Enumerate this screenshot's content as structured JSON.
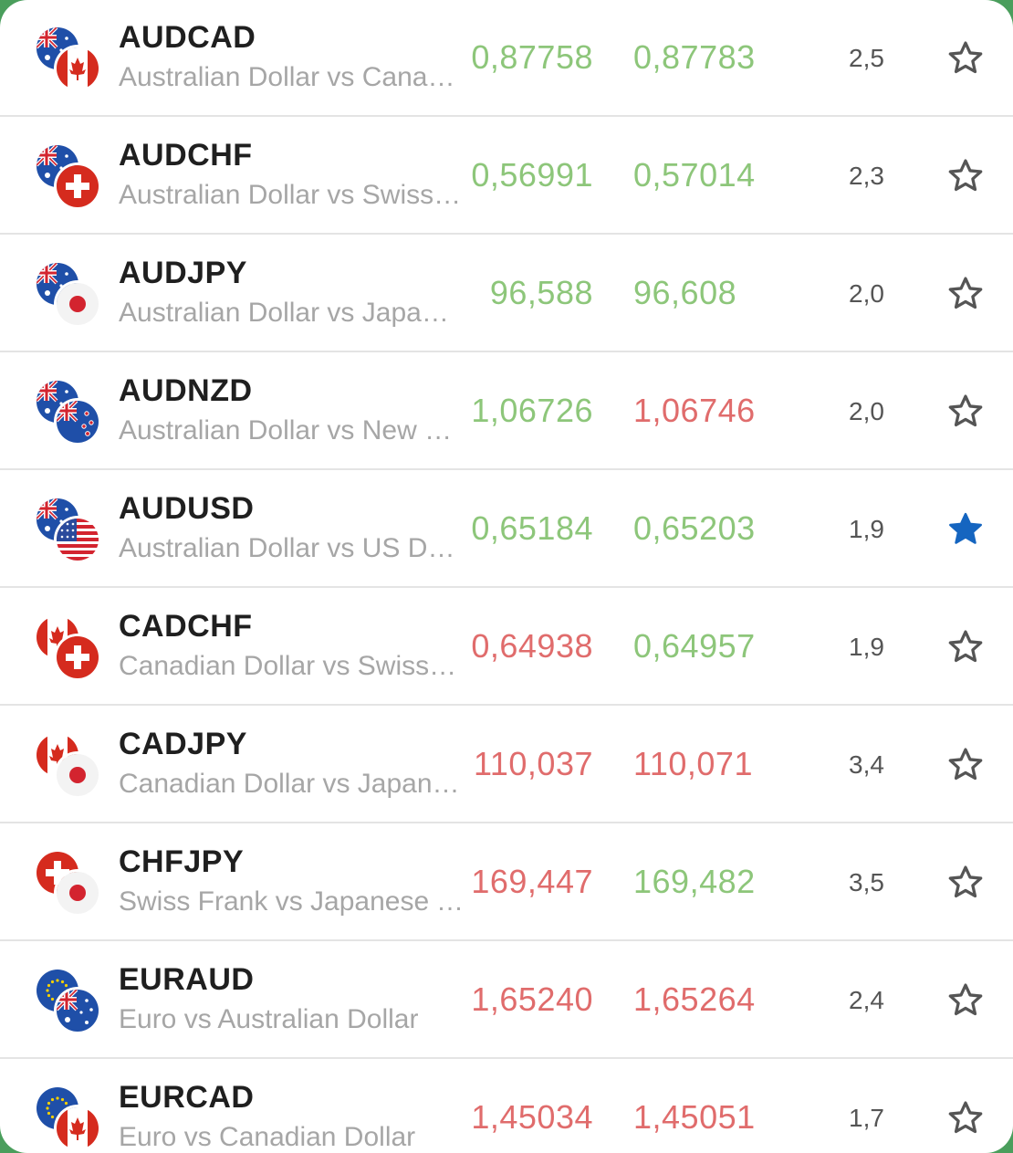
{
  "colors": {
    "up": "#8dc67a",
    "down": "#e06c6c",
    "star_active": "#1565c0",
    "star_inactive": "#555555"
  },
  "instruments": [
    {
      "symbol": "AUDCAD",
      "description": "Australian Dollar vs Canadian Dollar",
      "bid": "0,87758",
      "bid_dir": "up",
      "ask": "0,87783",
      "ask_dir": "up",
      "spread": "2,5",
      "favorite": false,
      "base_flag": "australia-flag-icon",
      "quote_flag": "canada-flag-icon"
    },
    {
      "symbol": "AUDCHF",
      "description": "Australian Dollar vs Swiss Frank",
      "bid": "0,56991",
      "bid_dir": "up",
      "ask": "0,57014",
      "ask_dir": "up",
      "spread": "2,3",
      "favorite": false,
      "base_flag": "australia-flag-icon",
      "quote_flag": "switzerland-flag-icon"
    },
    {
      "symbol": "AUDJPY",
      "description": "Australian Dollar vs Japanese Yen",
      "bid": "96,588",
      "bid_dir": "up",
      "ask": "96,608",
      "ask_dir": "up",
      "spread": "2,0",
      "favorite": false,
      "base_flag": "australia-flag-icon",
      "quote_flag": "japan-flag-icon"
    },
    {
      "symbol": "AUDNZD",
      "description": "Australian Dollar vs New Zealand Dollar",
      "bid": "1,06726",
      "bid_dir": "up",
      "ask": "1,06746",
      "ask_dir": "down",
      "spread": "2,0",
      "favorite": false,
      "base_flag": "australia-flag-icon",
      "quote_flag": "new-zealand-flag-icon"
    },
    {
      "symbol": "AUDUSD",
      "description": "Australian Dollar vs US Dollar",
      "bid": "0,65184",
      "bid_dir": "up",
      "ask": "0,65203",
      "ask_dir": "up",
      "spread": "1,9",
      "favorite": true,
      "base_flag": "australia-flag-icon",
      "quote_flag": "usa-flag-icon"
    },
    {
      "symbol": "CADCHF",
      "description": "Canadian Dollar vs Swiss Frank",
      "bid": "0,64938",
      "bid_dir": "down",
      "ask": "0,64957",
      "ask_dir": "up",
      "spread": "1,9",
      "favorite": false,
      "base_flag": "canada-flag-icon",
      "quote_flag": "switzerland-flag-icon"
    },
    {
      "symbol": "CADJPY",
      "description": "Canadian Dollar vs Japanese Yen",
      "bid": "110,037",
      "bid_dir": "down",
      "ask": "110,071",
      "ask_dir": "down",
      "spread": "3,4",
      "favorite": false,
      "base_flag": "canada-flag-icon",
      "quote_flag": "japan-flag-icon"
    },
    {
      "symbol": "CHFJPY",
      "description": "Swiss Frank vs Japanese Yen",
      "bid": "169,447",
      "bid_dir": "down",
      "ask": "169,482",
      "ask_dir": "up",
      "spread": "3,5",
      "favorite": false,
      "base_flag": "switzerland-flag-icon",
      "quote_flag": "japan-flag-icon"
    },
    {
      "symbol": "EURAUD",
      "description": "Euro vs Australian Dollar",
      "bid": "1,65240",
      "bid_dir": "down",
      "ask": "1,65264",
      "ask_dir": "down",
      "spread": "2,4",
      "favorite": false,
      "base_flag": "eu-flag-icon",
      "quote_flag": "australia-flag-icon"
    },
    {
      "symbol": "EURCAD",
      "description": "Euro vs Canadian Dollar",
      "bid": "1,45034",
      "bid_dir": "down",
      "ask": "1,45051",
      "ask_dir": "down",
      "spread": "1,7",
      "favorite": false,
      "base_flag": "eu-flag-icon",
      "quote_flag": "canada-flag-icon"
    }
  ]
}
